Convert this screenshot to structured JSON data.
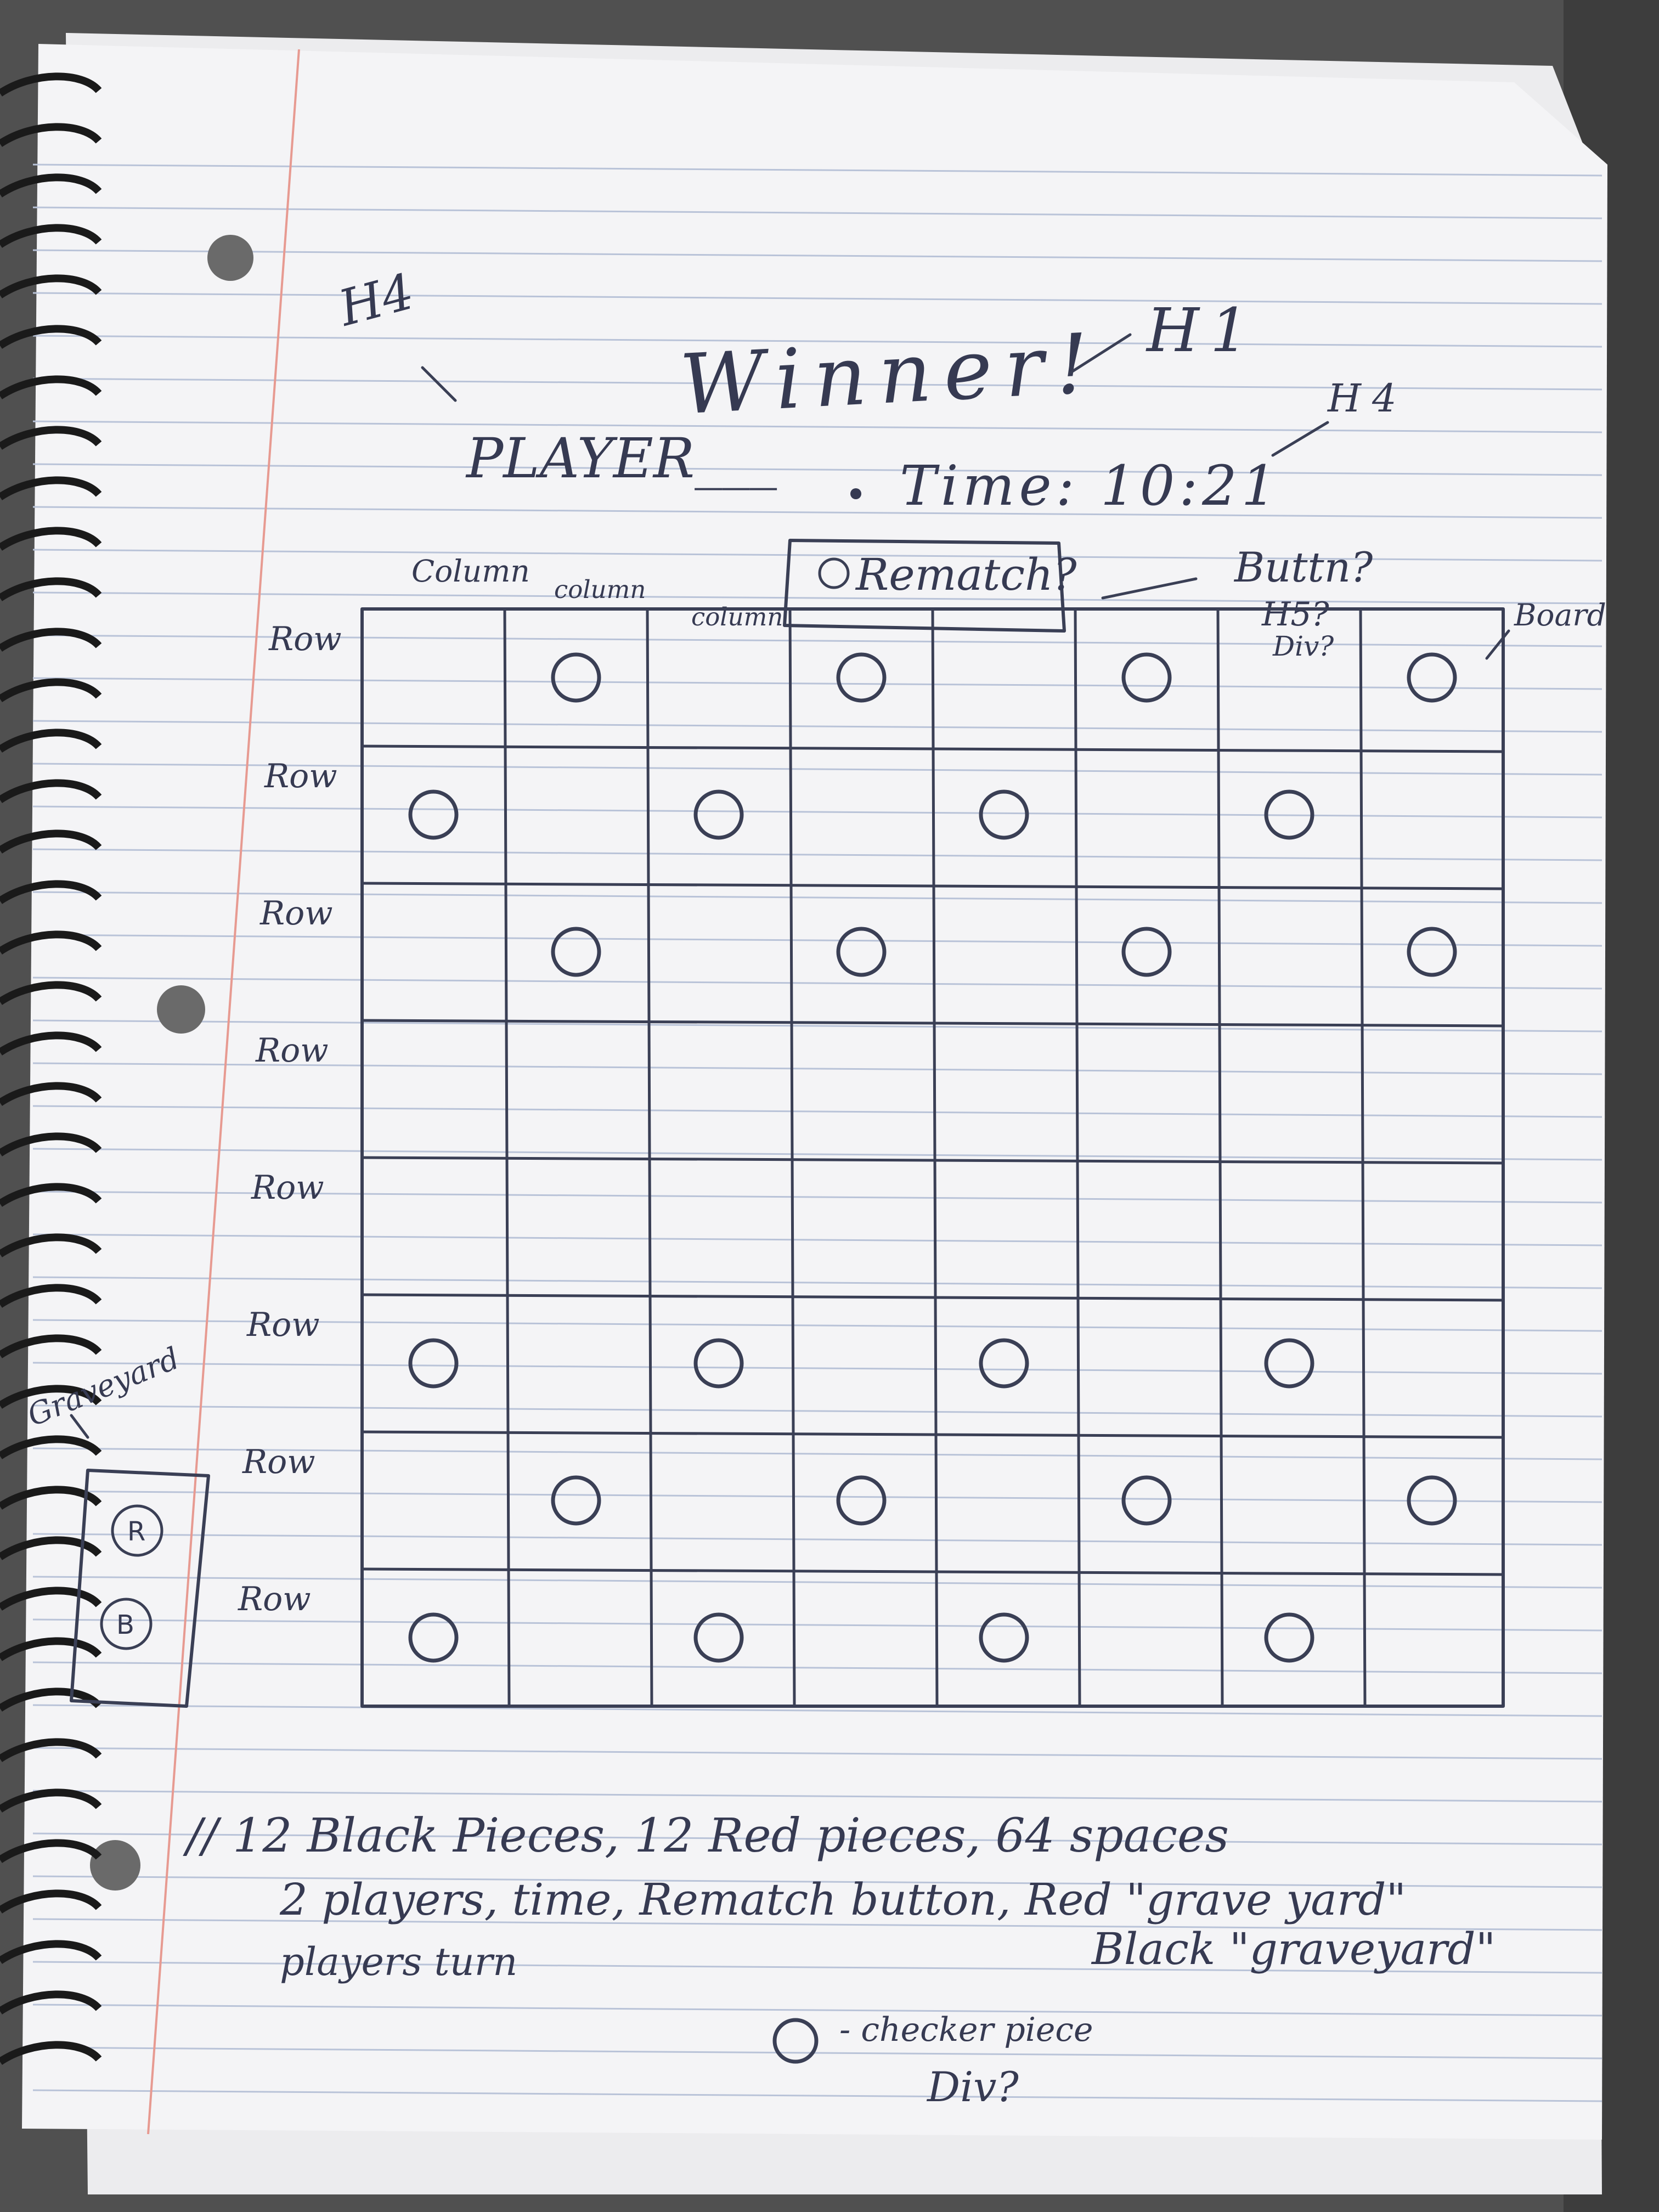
{
  "sketch": {
    "title": "Winner!",
    "title_note": "H1",
    "player_label": "PLAYER___",
    "player_note": "H4",
    "time_label": "Time: 10:21",
    "time_note": "H4",
    "rematch_button": "Rematch?",
    "rematch_note": [
      "Buttn?",
      "H5?",
      "Div?"
    ],
    "board_note": "Board",
    "column_labels": [
      "Column",
      "column",
      "column"
    ],
    "row_labels": [
      "Row",
      "Row",
      "Row",
      "Row",
      "Row",
      "Row",
      "Row",
      "Row"
    ],
    "graveyard_label": "Graveyard",
    "graveyard_pieces": [
      "R",
      "B"
    ],
    "board": {
      "rows": 8,
      "cols": 8,
      "pieces": [
        [
          0,
          1
        ],
        [
          0,
          3
        ],
        [
          0,
          5
        ],
        [
          0,
          7
        ],
        [
          1,
          0
        ],
        [
          1,
          2
        ],
        [
          1,
          4
        ],
        [
          1,
          6
        ],
        [
          2,
          1
        ],
        [
          2,
          3
        ],
        [
          2,
          5
        ],
        [
          2,
          7
        ],
        [
          5,
          0
        ],
        [
          5,
          2
        ],
        [
          5,
          4
        ],
        [
          5,
          6
        ],
        [
          6,
          1
        ],
        [
          6,
          3
        ],
        [
          6,
          5
        ],
        [
          6,
          7
        ],
        [
          7,
          0
        ],
        [
          7,
          2
        ],
        [
          7,
          4
        ],
        [
          7,
          6
        ]
      ]
    },
    "notes": [
      "// 12 Black Pieces, 12 Red pieces, 64 spaces",
      "2 players, time, Rematch button, Red \"grave yard\"",
      "Black \"graveyard\"",
      "players turn"
    ],
    "legend": [
      "- checker piece",
      "Div?"
    ]
  }
}
